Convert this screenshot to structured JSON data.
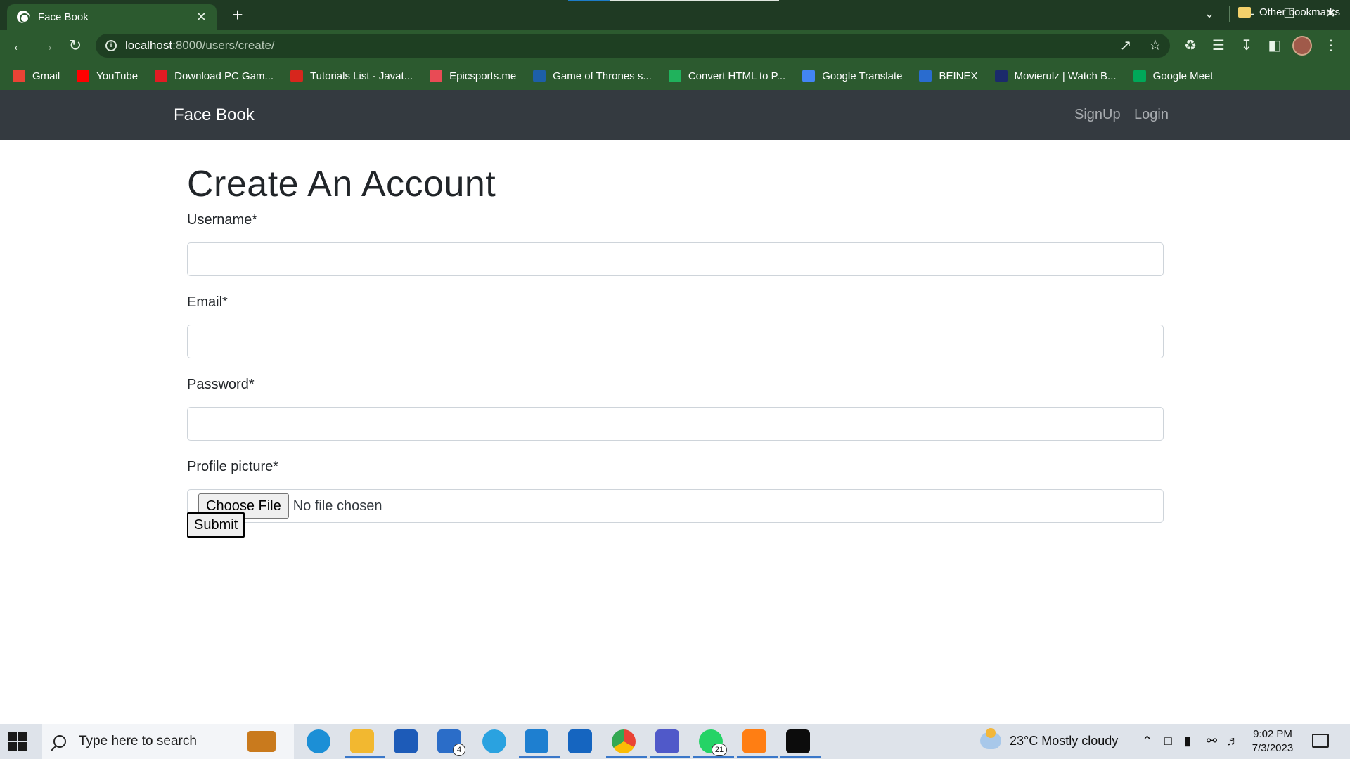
{
  "browser": {
    "tab_title": "Face Book",
    "tab_close": "✕",
    "new_tab": "+",
    "url_host": "localhost",
    "url_path": ":8000/users/create/",
    "bookmarks": [
      {
        "label": "Gmail",
        "color": "#ea4335"
      },
      {
        "label": "YouTube",
        "color": "#ff0000"
      },
      {
        "label": "Download PC Gam...",
        "color": "#e21b23"
      },
      {
        "label": "Tutorials List - Javat...",
        "color": "#d7261d"
      },
      {
        "label": "Epicsports.me",
        "color": "#e84b55"
      },
      {
        "label": "Game of Thrones s...",
        "color": "#1d5fa8"
      },
      {
        "label": "Convert HTML to P...",
        "color": "#20b25c"
      },
      {
        "label": "Google Translate",
        "color": "#4285f4"
      },
      {
        "label": "BEINEX",
        "color": "#2a6ccf"
      },
      {
        "label": "Movierulz | Watch B...",
        "color": "#1b2a6b"
      },
      {
        "label": "Google Meet",
        "color": "#00a859"
      }
    ],
    "other_bookmarks": "Other bookmarks"
  },
  "navbar": {
    "brand": "Face Book",
    "links": [
      "SignUp",
      "Login"
    ]
  },
  "form": {
    "heading": "Create An Account",
    "username_label": "Username*",
    "email_label": "Email*",
    "password_label": "Password*",
    "picture_label": "Profile picture*",
    "choose_file": "Choose File",
    "no_file": "No file chosen",
    "submit": "Submit"
  },
  "taskbar": {
    "search_placeholder": "Type here to search",
    "weather": "23°C  Mostly cloudy",
    "time": "9:02 PM",
    "date": "7/3/2023",
    "mail_badge": "4",
    "whatsapp_badge": "21"
  }
}
